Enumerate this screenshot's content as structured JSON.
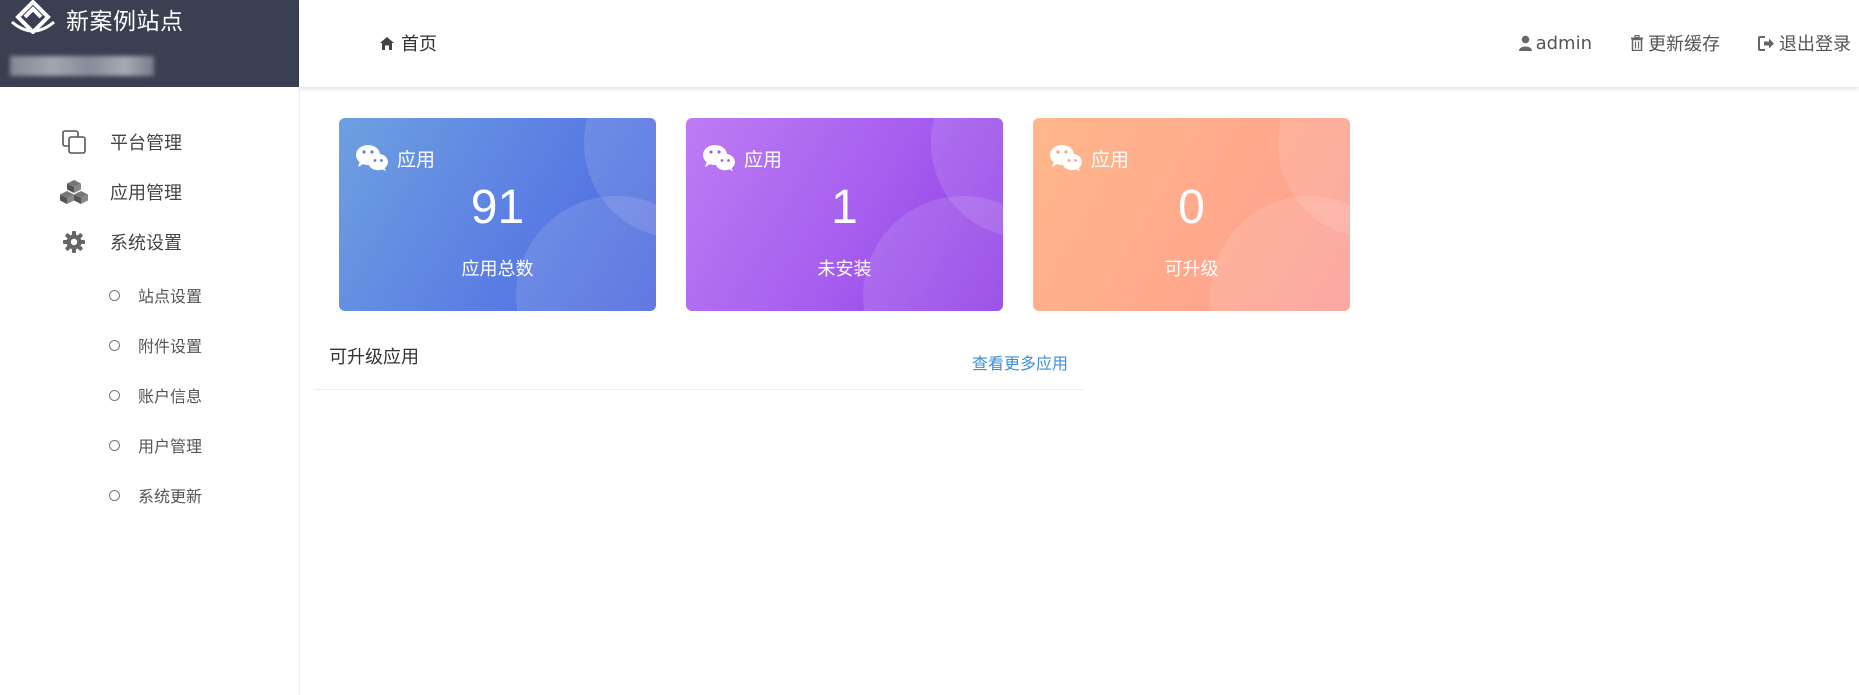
{
  "brand": {
    "site_name": "新案例站点",
    "logo_icon": "house-diamond-logo"
  },
  "header": {
    "home_label": "首页",
    "user_label": "admin",
    "cache_label": "更新缓存",
    "logout_label": "退出登录"
  },
  "sidebar": {
    "items": [
      {
        "label": "平台管理",
        "icon": "copy-icon"
      },
      {
        "label": "应用管理",
        "icon": "cubes-icon"
      },
      {
        "label": "系统设置",
        "icon": "gear-icon"
      }
    ],
    "sub_items": [
      {
        "label": "站点设置"
      },
      {
        "label": "附件设置"
      },
      {
        "label": "账户信息"
      },
      {
        "label": "用户管理"
      },
      {
        "label": "系统更新"
      }
    ]
  },
  "cards": [
    {
      "title": "应用",
      "value": "91",
      "subtitle": "应用总数",
      "color": "#5b7fe3"
    },
    {
      "title": "应用",
      "value": "1",
      "subtitle": "未安装",
      "color": "#a55eee"
    },
    {
      "title": "应用",
      "value": "0",
      "subtitle": "可升级",
      "color": "#ffa98c"
    }
  ],
  "section": {
    "title": "可升级应用",
    "more_link": "查看更多应用"
  }
}
